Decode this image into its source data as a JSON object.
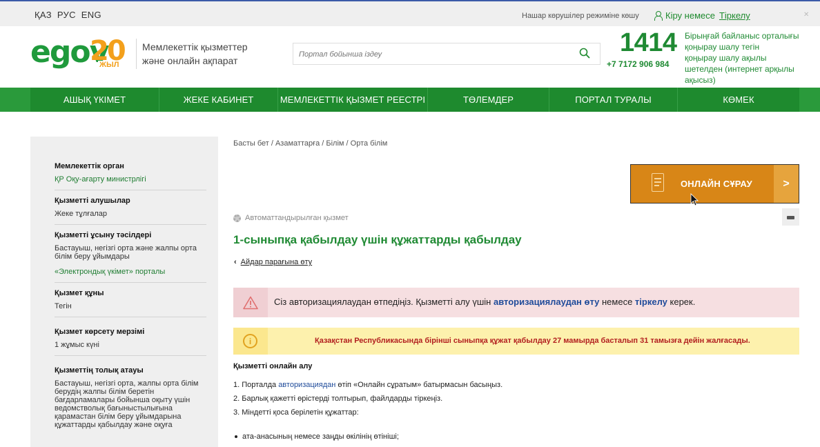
{
  "topbar": {
    "langs": [
      "ҚАЗ",
      "РУС",
      "ENG"
    ],
    "blind_mode": "Нашар көрушілер режиміне көшу",
    "login": "Кіру немесе",
    "register": "Тіркелу"
  },
  "header": {
    "logo_text": "egov",
    "logo_num": "20",
    "logo_sub": "ЖЫЛ",
    "tagline_1": "Мемлекеттік қызметтер",
    "tagline_2": "және онлайн ақпарат",
    "search_placeholder": "Портал бойынша іздеу",
    "hotline": "1414",
    "hotline_phone": "+7 7172 906 984",
    "hotline_desc_1": "Бірыңғай байланыс орталығы",
    "hotline_desc_2": "қоңырау шалу тегін",
    "hotline_desc_3": "қоңырау шалу ақылы",
    "hotline_desc_4": "шетелден (",
    "hotline_desc_link": "интернет арқылы ақысыз",
    "hotline_desc_5": ")"
  },
  "nav": {
    "items": [
      {
        "label": "АШЫҚ ҮКІМЕТ"
      },
      {
        "label": "ЖЕКЕ КАБИНЕТ"
      },
      {
        "label": "МЕМЛЕКЕТТІК ҚЫЗМЕТ РЕЕСТРІ"
      },
      {
        "label": "ТӨЛЕМДЕР"
      },
      {
        "label": "ПОРТАЛ ТУРАЛЫ"
      },
      {
        "label": "КӨМЕК"
      }
    ]
  },
  "sidebar": {
    "organ_h": "Мемлекеттік орган",
    "organ_v": "ҚР Оқу-ағарту министрлігі",
    "recipients_h": "Қызметті алушылар",
    "recipients_v": "Жеке тұлғалар",
    "methods_h": "Қызметті ұсыну тәсілдері",
    "methods_v1": "Бастауыш, негізгі орта және жалпы орта білім беру ұйымдары",
    "methods_v2": "«Электрондық үкімет» порталы",
    "price_h": "Қызмет құны",
    "price_v": "Тегін",
    "term_h": "Қызмет көрсету мерзімі",
    "term_v": "1 жұмыс күні",
    "fullname_h": "Қызметтің толық атауы",
    "fullname_v": "Бастауыш, негізгі орта, жалпы орта білім берудің жалпы білім беретін бағдарламалары бойынша оқыту үшін ведомстволық бағыныстылығына қарамастан білім беру ұйымдарына құжаттарды қабылдау және оқуға"
  },
  "main": {
    "breadcrumb": "Басты бет / Азаматтарға / Білім / Орта білім",
    "online_btn": "ОНЛАЙН СҰРАУ",
    "auto_service": "Автоматтандырылған қызмет",
    "title": "1-сыныпқа қабылдау үшін құжаттарды қабылдау",
    "back": "Айдар парағына өту",
    "alert_red_1": "Сіз авторизациялаудан өтпедіңіз. Қызметті алу үшін ",
    "alert_red_link1": "авторизациялаудан өту",
    "alert_red_2": " немесе ",
    "alert_red_link2": "тіркелу",
    "alert_red_3": " керек.",
    "alert_yellow": "Қазақстан Республикасында бірінші сыныпқа құжат қабылдау 27 мамырда басталып 31 тамызға дейін жалғасады.",
    "section_h": "Қызметті онлайн алу",
    "step1_a": "1. Порталда ",
    "step1_link": "авторизациядан",
    "step1_b": " өтіп «Онлайн сұратым» батырмасын басыңыз.",
    "step2": "2. Барлық қажетті өрістерді толтырып, файлдарды тіркеңіз.",
    "step3": "3. Міндетті қоса берілетін құжаттар:",
    "bullet1": "ата-анасының немесе заңды өкілінің өтініші;"
  }
}
